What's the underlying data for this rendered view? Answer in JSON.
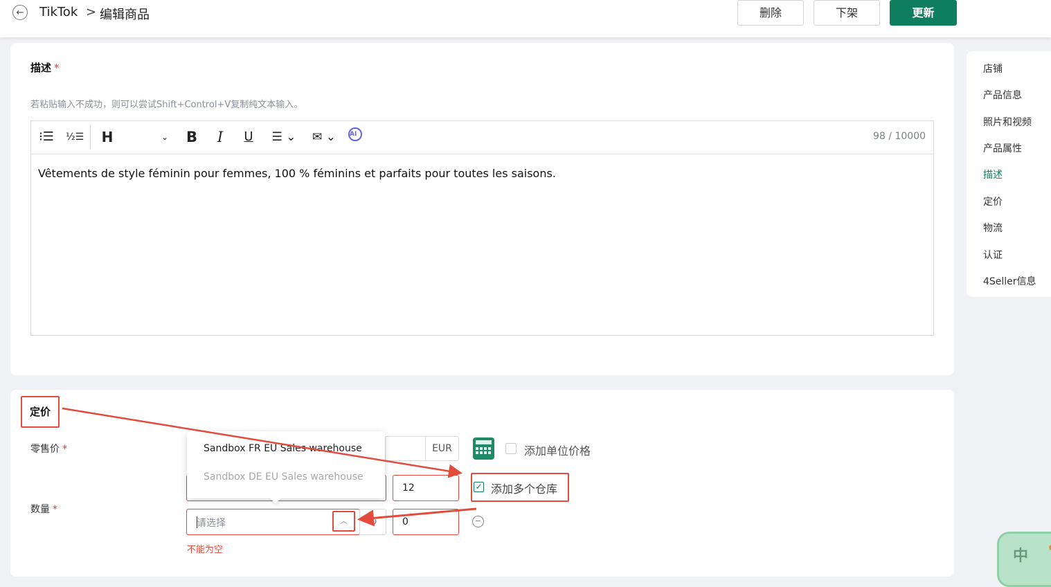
{
  "header": {
    "back_icon": "arrow-left-icon",
    "breadcrumb_root": "TikTok",
    "breadcrumb_separator": ">",
    "page_title": "编辑商品",
    "delete_label": "删除",
    "delist_label": "下架",
    "update_label": "更新",
    "accent_color": "#0f7e5e"
  },
  "description": {
    "title": "描述",
    "required_mark": "*",
    "hint": "若粘贴输入不成功，则可以尝试Shift+Control+V复制纯文本输入。",
    "counter": "98 / 10000",
    "content": "Vêtements de style féminin pour femmes, 100 % féminins et parfaits pour toutes les saisons.",
    "toolbar": {
      "bullet_list_glyph": "⁝☰",
      "ordered_list_glyph": "½☰",
      "heading_label": "H",
      "bold_label": "B",
      "italic_label": "I",
      "underline_label": "U",
      "align_glyph": "☰ ⌄",
      "image_glyph": "✉ ⌄",
      "ai_label": "AI",
      "dropdown_glyph": "⌄"
    }
  },
  "sidenav": {
    "items": [
      {
        "label": "店铺",
        "active": false
      },
      {
        "label": "产品信息",
        "active": false
      },
      {
        "label": "照片和视频",
        "active": false
      },
      {
        "label": "产品属性",
        "active": false
      },
      {
        "label": "描述",
        "active": true
      },
      {
        "label": "定价",
        "active": false
      },
      {
        "label": "物流",
        "active": false
      },
      {
        "label": "认证",
        "active": false
      },
      {
        "label": "4Seller信息",
        "active": false
      }
    ]
  },
  "pricing": {
    "title": "定价",
    "retail_price_label": "零售价",
    "quantity_label": "数量",
    "required_mark": "*",
    "currency": "EUR",
    "add_unit_price_label": "添加单位价格",
    "add_unit_price_checked": false,
    "add_multi_warehouse_label": "添加多个仓库",
    "add_multi_warehouse_checked": true,
    "checkmark_glyph": "✓",
    "warehouse_stock_1": "12",
    "warehouse_stock_2": "0",
    "warehouse_placeholder": "请选择",
    "chevron_up_glyph": "︿",
    "refresh_glyph": "↻",
    "remove_glyph": "−",
    "error_text": "不能为空",
    "dropdown_options": [
      {
        "label": "Sandbox FR EU Sales warehouse",
        "disabled": false
      },
      {
        "label": "Sandbox DE EU Sales warehouse",
        "disabled": true
      }
    ]
  },
  "ime": {
    "label": "中"
  },
  "colors": {
    "annotation_red": "#e34b3d",
    "error": "#e34b3d",
    "muted_text": "#8a8f98"
  }
}
